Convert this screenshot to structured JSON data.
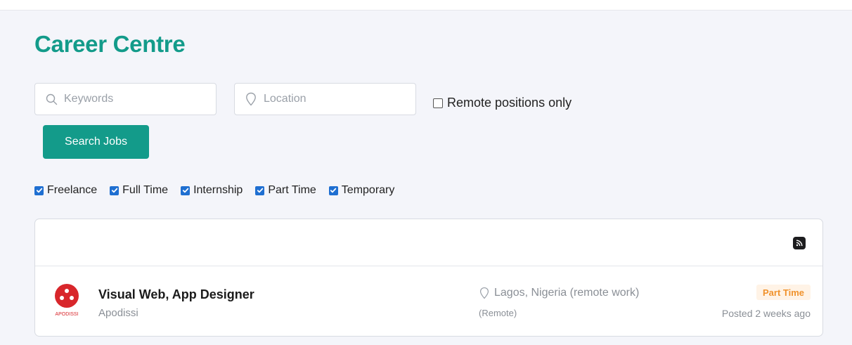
{
  "page": {
    "title": "Career Centre"
  },
  "search": {
    "keywords_placeholder": "Keywords",
    "keywords_icon": "search-icon",
    "location_placeholder": "Location",
    "location_icon": "map-pin-icon",
    "remote_label": "Remote positions only",
    "remote_checked": false,
    "button_label": "Search Jobs"
  },
  "job_types": [
    {
      "label": "Freelance",
      "checked": true
    },
    {
      "label": "Full Time",
      "checked": true
    },
    {
      "label": "Internship",
      "checked": true
    },
    {
      "label": "Part Time",
      "checked": true
    },
    {
      "label": "Temporary",
      "checked": true
    }
  ],
  "listing": {
    "feed_icon": "rss-icon",
    "jobs": [
      {
        "title": "Visual Web, App Designer",
        "company": "Apodissi",
        "logo_text": "APODISSI",
        "location": "Lagos, Nigeria (remote work)",
        "remote_tag": "(Remote)",
        "type": "Part Time",
        "posted": "Posted 2 weeks ago"
      }
    ]
  },
  "colors": {
    "accent": "#139b8a",
    "checkbox": "#1f6fd1",
    "badge_bg": "#fff3e6",
    "badge_text": "#f0922c",
    "logo_red": "#d8262b"
  }
}
